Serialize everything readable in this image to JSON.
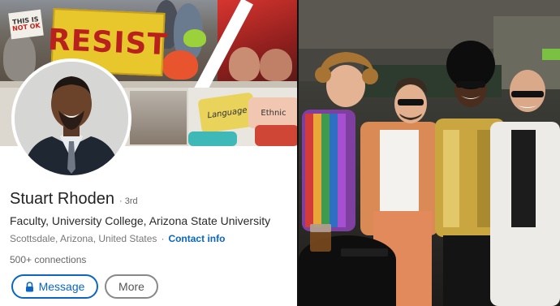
{
  "banner": {
    "protest_sign": "RESIST",
    "small_sign_line1": "THIS IS",
    "small_sign_line2": "NOT OK",
    "puzzle_language": "Language",
    "puzzle_ethnic": "Ethnic"
  },
  "profile": {
    "name": "Stuart Rhoden",
    "degree": "· 3rd",
    "headline": "Faculty, University College, Arizona State University",
    "location": "Scottsdale, Arizona, United States",
    "separator": "·",
    "contact_info": "Contact info",
    "connections": "500+ connections"
  },
  "actions": {
    "message_label": "Message",
    "more_label": "More"
  },
  "icons": {
    "message": "lock-icon"
  },
  "colors": {
    "link_blue": "#0a66c2",
    "resist_yellow": "#e7c72b",
    "resist_red": "#b8211d"
  }
}
